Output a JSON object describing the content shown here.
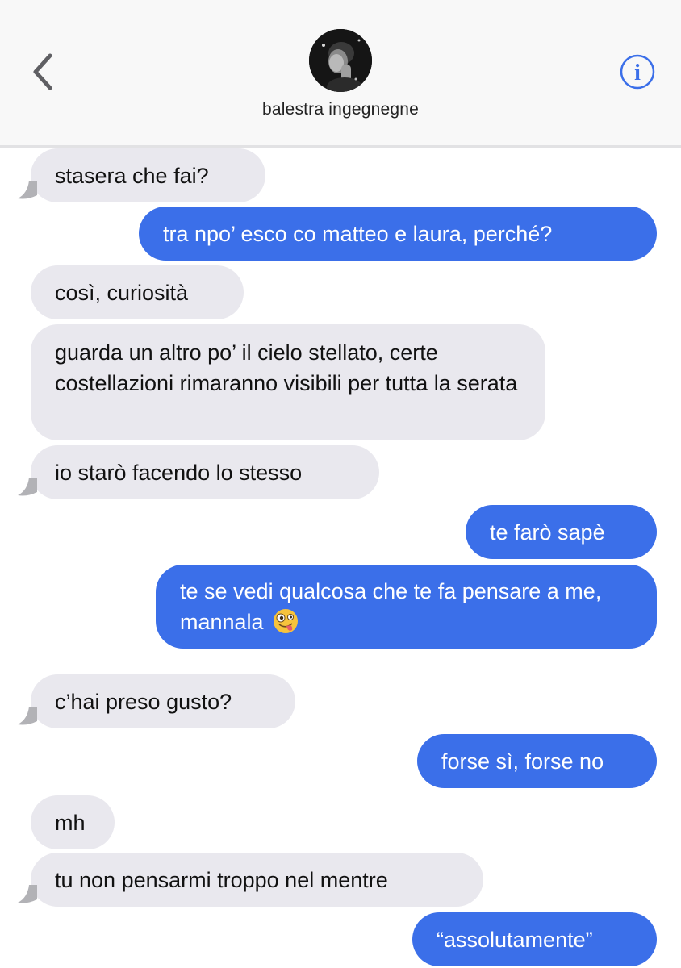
{
  "header": {
    "contact_name": "balestra ingegnegne",
    "back_icon": "chevron-left-icon",
    "info_icon": "info-icon",
    "accent_color": "#3b6fe9"
  },
  "messages": [
    {
      "direction": "incoming",
      "text": "stasera che fai?"
    },
    {
      "direction": "outgoing",
      "text": "tra npo’ esco co matteo e laura, perché?"
    },
    {
      "direction": "incoming",
      "text": "così, curiosità"
    },
    {
      "direction": "incoming",
      "text": "guarda un altro po’ il cielo stellato, certe costellazioni rimaranno visibili per tutta la serata"
    },
    {
      "direction": "incoming",
      "text": "io starò facendo lo stesso"
    },
    {
      "direction": "outgoing",
      "text": "te farò sapè"
    },
    {
      "direction": "outgoing",
      "text": "te se vedi qualcosa che te fa pensare a me, mannala",
      "emoji": "zany-face-emoji"
    },
    {
      "direction": "incoming",
      "text": "c’hai preso gusto?"
    },
    {
      "direction": "outgoing",
      "text": "forse sì, forse no"
    },
    {
      "direction": "incoming",
      "text": "mh"
    },
    {
      "direction": "incoming",
      "text": "tu non pensarmi troppo nel mentre"
    },
    {
      "direction": "outgoing",
      "text": "“assolutamente”"
    }
  ],
  "colors": {
    "incoming_bubble": "#e9e8ee",
    "outgoing_bubble": "#3b6fe9"
  }
}
